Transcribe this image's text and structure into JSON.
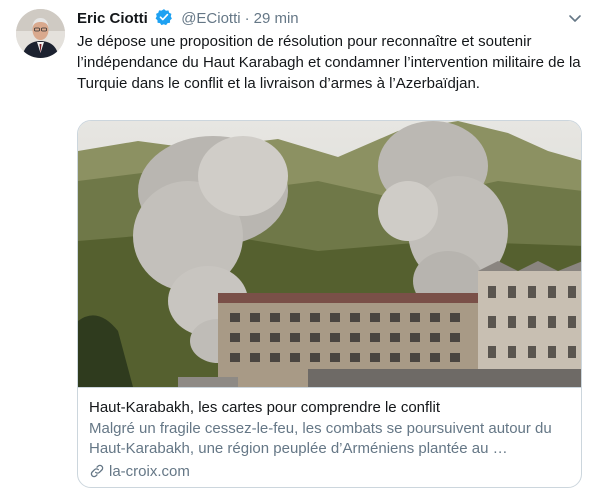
{
  "tweet": {
    "author_name": "Eric Ciotti",
    "handle": "@ECiotti",
    "separator": "·",
    "time": "29 min",
    "text": "Je dépose une proposition de résolution pour reconnaître et soutenir l’indépendance du Haut Karabagh et condamner l’intervention militaire de la Turquie dans le conflit et la livraison d’armes à l’Azerbaïdjan.",
    "verified_icon": "verified-badge-icon",
    "menu_icon": "chevron-down-icon"
  },
  "card": {
    "title": "Haut-Karabakh, les cartes pour comprendre le conflit",
    "description": "Malgré un fragile cessez-le-feu, les combats se poursuivent autour du Haut-Karabakh, une région peuplée d’Arméniens plantée au …",
    "domain": "la-croix.com",
    "domain_icon": "link-icon"
  },
  "colors": {
    "text": "#14171a",
    "secondary": "#657786",
    "verified": "#1da1f2",
    "border": "#ccd6dd"
  }
}
